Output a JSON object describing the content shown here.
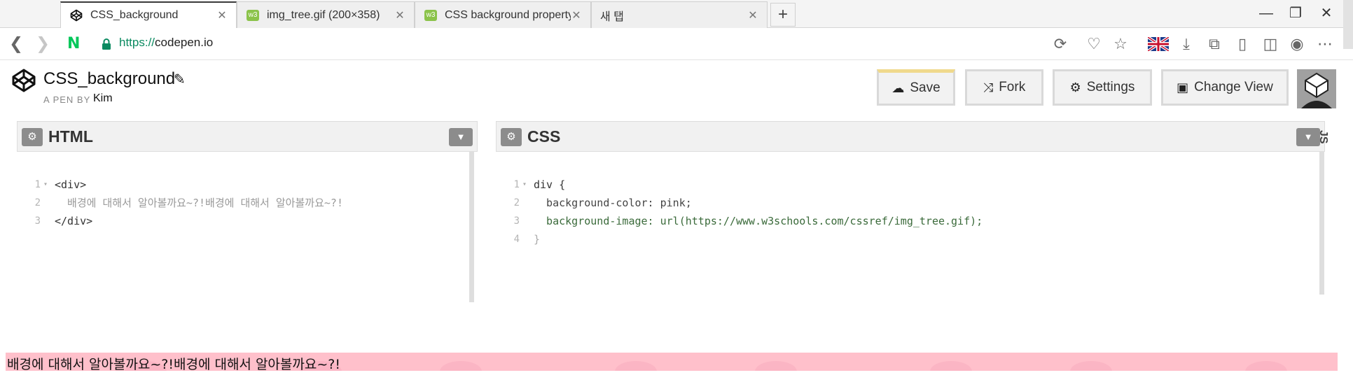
{
  "browser": {
    "tabs": [
      {
        "label": "CSS_background",
        "icon": "codepen-icon",
        "active": true
      },
      {
        "label": "img_tree.gif (200×358)",
        "icon": "w3schools-icon",
        "active": false
      },
      {
        "label": "CSS background property",
        "icon": "w3schools-icon",
        "active": false
      },
      {
        "label": "새 탭",
        "icon": "none",
        "active": false
      }
    ],
    "new_tab_symbol": "+",
    "window_controls": {
      "minimize": "—",
      "restore": "❐",
      "close": "✕"
    },
    "address": {
      "scheme": "https://",
      "host": "codepen.io"
    },
    "naver_letter": "N",
    "w3_favicon_text": "w3"
  },
  "codepen": {
    "pen_title": "CSS_background",
    "edit_symbol": "✎",
    "by_label": "A PEN BY",
    "author": "Kim",
    "buttons": {
      "save": "Save",
      "fork": "Fork",
      "settings": "Settings",
      "change_view": "Change View"
    },
    "js_tab_label": "JS"
  },
  "editors": {
    "html": {
      "title": "HTML",
      "lines": [
        {
          "n": "1",
          "fold": "▾",
          "code": "<div>"
        },
        {
          "n": "2",
          "fold": "",
          "code": "  배경에 대해서 알아볼까요~?!배경에 대해서 알아볼까요~?!"
        },
        {
          "n": "3",
          "fold": "",
          "code": "</div>"
        }
      ]
    },
    "css": {
      "title": "CSS",
      "lines": [
        {
          "n": "1",
          "fold": "▾",
          "code": "div {"
        },
        {
          "n": "2",
          "fold": "",
          "code": "  background-color: pink;"
        },
        {
          "n": "3",
          "fold": "",
          "code": "  background-image: url(https://www.w3schools.com/cssref/img_tree.gif);"
        },
        {
          "n": "4",
          "fold": "",
          "code": "}"
        }
      ]
    }
  },
  "preview": {
    "text": "배경에 대해서 알아볼까요~?!배경에 대해서 알아볼까요~?!",
    "background_color": "#ffc0cb"
  },
  "colors": {
    "accent_save": "#f0d98c",
    "naver_green": "#03c75a",
    "lock_green": "#0a8a60"
  }
}
